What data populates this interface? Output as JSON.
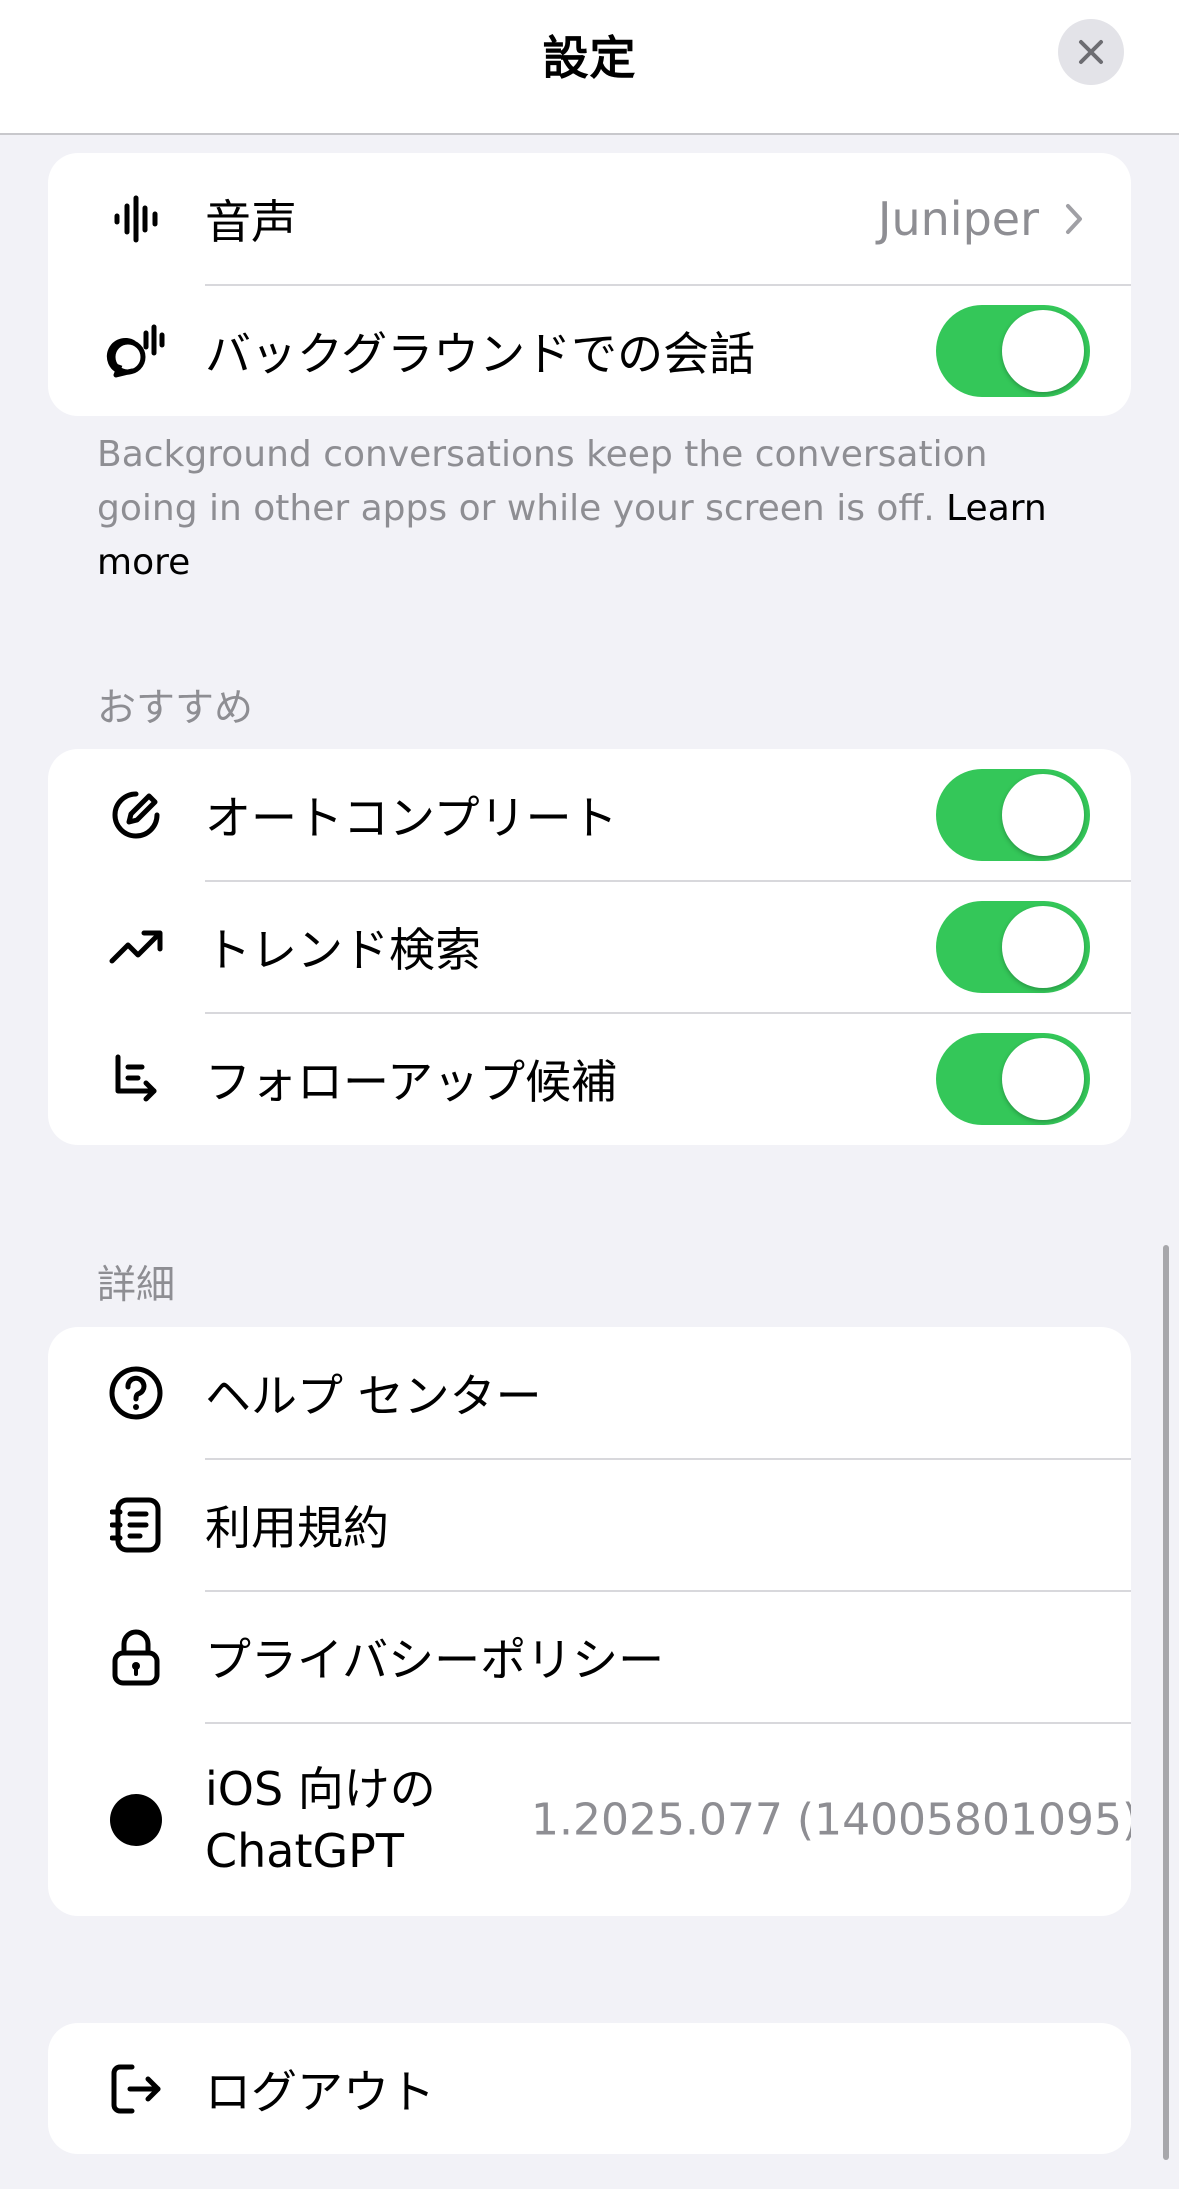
{
  "header": {
    "title": "設定",
    "close_icon": "xmark-icon"
  },
  "voice_group": {
    "voice": {
      "label": "音声",
      "value": "Juniper",
      "icon": "waveform-icon"
    },
    "background": {
      "label": "バックグラウンドでの会話",
      "icon": "speech-bubble-waveform-icon",
      "on": true
    }
  },
  "footnote": {
    "text": "Background conversations keep the conversation going in other apps or while your screen is off. ",
    "link": "Learn more"
  },
  "recommend": {
    "title": "おすすめ",
    "items": [
      {
        "label": "オートコンプリート",
        "icon": "pen-bubble-icon",
        "on": true
      },
      {
        "label": "トレンド検索",
        "icon": "trending-up-arrow-icon",
        "on": true
      },
      {
        "label": "フォローアップ候補",
        "icon": "follow-up-arrow-icon",
        "on": true
      }
    ]
  },
  "details": {
    "title": "詳細",
    "items": [
      {
        "label": "ヘルプ センター",
        "icon": "question-circle-icon"
      },
      {
        "label": "利用規約",
        "icon": "notebook-icon"
      },
      {
        "label": "プライバシーポリシー",
        "icon": "lock-icon"
      }
    ],
    "version": {
      "label_line1": "iOS 向けの",
      "label_line2": "ChatGPT",
      "value": "1.2025.077 (14005801095)",
      "icon": "openai-logo-icon"
    }
  },
  "logout": {
    "label": "ログアウト",
    "icon": "logout-arrow-icon"
  },
  "colors": {
    "toggle_on": "#34c759",
    "background": "#f2f2f7",
    "secondary_text": "#8e8e93"
  }
}
